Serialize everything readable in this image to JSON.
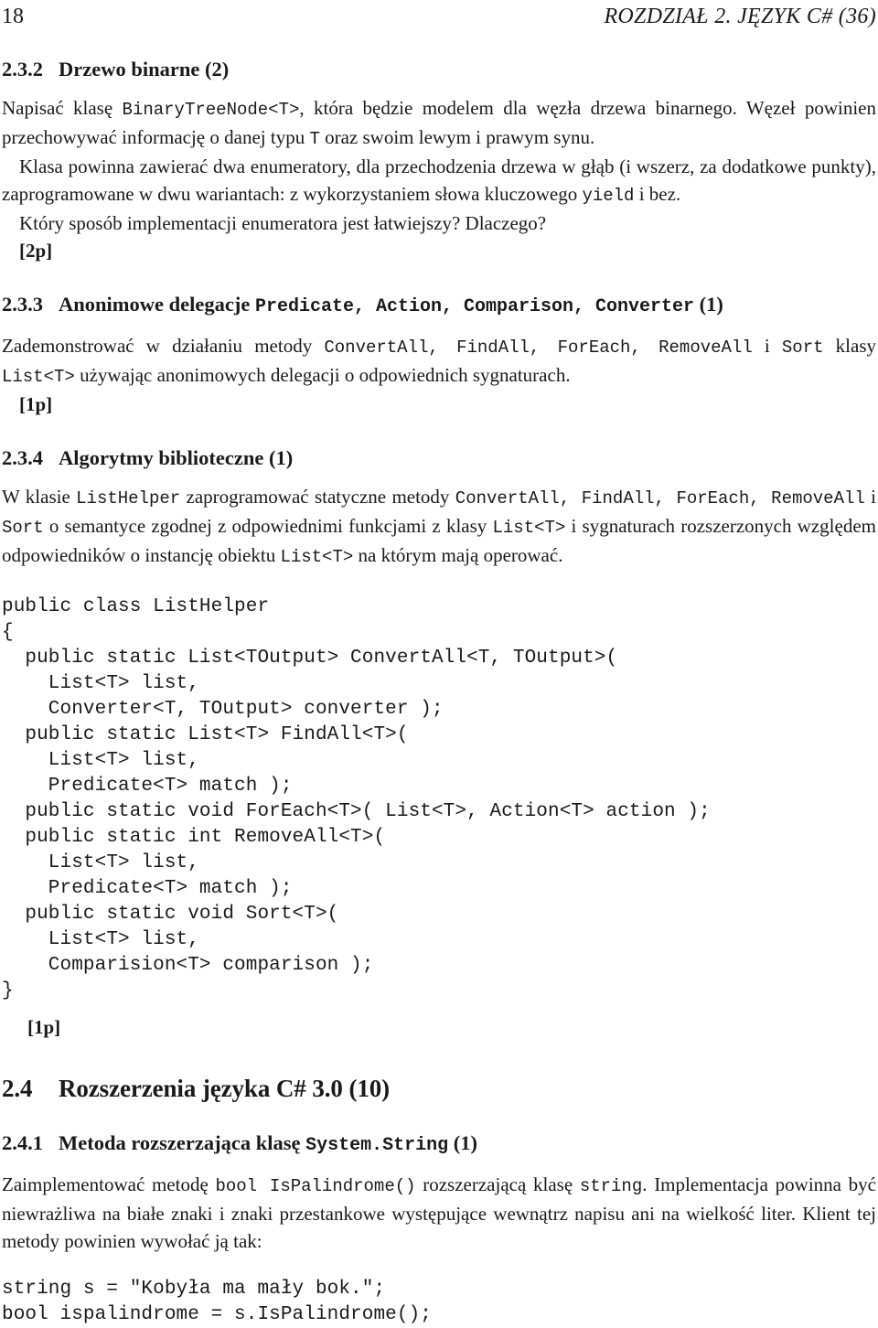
{
  "running_head": {
    "folio": "18",
    "chapter_title": "ROZDZIAŁ 2.   JĘZYK C# (36)"
  },
  "sections": {
    "s232": {
      "number": "2.3.2",
      "title": "Drzewo binarne (2)",
      "para1_a": "Napisać klasę ",
      "para1_code1": "BinaryTreeNode<T>",
      "para1_b": ", która będzie modelem dla węzła drzewa binarnego. Węzeł powinien przechowywać informację o danej typu ",
      "para1_code2": "T",
      "para1_c": " oraz swoim lewym i prawym synu.",
      "para2_a": "Klasa powinna zawierać dwa enumeratory, dla przechodzenia drzewa w głąb (i wszerz, za dodatkowe punkty), zaprogramowane w dwu wariantach: z wykorzystaniem słowa kluczowego ",
      "para2_code": "yield",
      "para2_b": " i bez.",
      "para3": "Który sposób implementacji enumeratora jest łatwiejszy? Dlaczego?",
      "points": "[2p]"
    },
    "s233": {
      "number": "2.3.3",
      "title_a": "Anonimowe delegacje ",
      "title_code": "Predicate, Action, Comparison, Converter",
      "title_b": " (1)",
      "para_a": "Zademonstrować w działaniu metody ",
      "para_code1": "ConvertAll, FindAll, ForEach, RemoveAll",
      "para_b": " i ",
      "para_code2": "Sort",
      "para_c": " klasy ",
      "para_code3": "List<T>",
      "para_d": " używając anonimowych delegacji o odpowiednich sygnaturach.",
      "points": "[1p]"
    },
    "s234": {
      "number": "2.3.4",
      "title": "Algorytmy biblioteczne (1)",
      "para_a": "W klasie ",
      "para_code1": "ListHelper",
      "para_b": " zaprogramować statyczne metody ",
      "para_code2": "ConvertAll, FindAll, ForEach, RemoveAll",
      "para_c": " i ",
      "para_code3": "Sort",
      "para_d": " o semantyce zgodnej z odpowiednimi funkcjami z klasy ",
      "para_code4": "List<T>",
      "para_e": " i sygnaturach rozszerzonych względem odpowiedników o instancję obiektu ",
      "para_code5": "List<T>",
      "para_f": " na którym mają operować.",
      "code_block": "public class ListHelper\n{\n  public static List<TOutput> ConvertAll<T, TOutput>(\n    List<T> list,\n    Converter<T, TOutput> converter );\n  public static List<T> FindAll<T>(\n    List<T> list,\n    Predicate<T> match );\n  public static void ForEach<T>( List<T>, Action<T> action );\n  public static int RemoveAll<T>(\n    List<T> list,\n    Predicate<T> match );\n  public static void Sort<T>(\n    List<T> list,\n    Comparision<T> comparison );\n}",
      "points": "[1p]"
    },
    "s24": {
      "number": "2.4",
      "title": "Rozszerzenia języka C# 3.0 (10)"
    },
    "s241": {
      "number": "2.4.1",
      "title_a": "Metoda rozszerzająca klasę ",
      "title_code": "System.String",
      "title_b": " (1)",
      "para_a": "Zaimplementować metodę ",
      "para_code1": "bool IsPalindrome()",
      "para_b": " rozszerzającą klasę ",
      "para_code2": "string",
      "para_c": ". Implementacja powinna być niewrażliwa na białe znaki i znaki przestankowe występujące wewnątrz napisu ani na wielkość liter. Klient tej metody powinien wywołać ją tak:",
      "code_block": "string s = \"Kobyła ma mały bok.\";\nbool ispalindrome = s.IsPalindrome();"
    }
  }
}
